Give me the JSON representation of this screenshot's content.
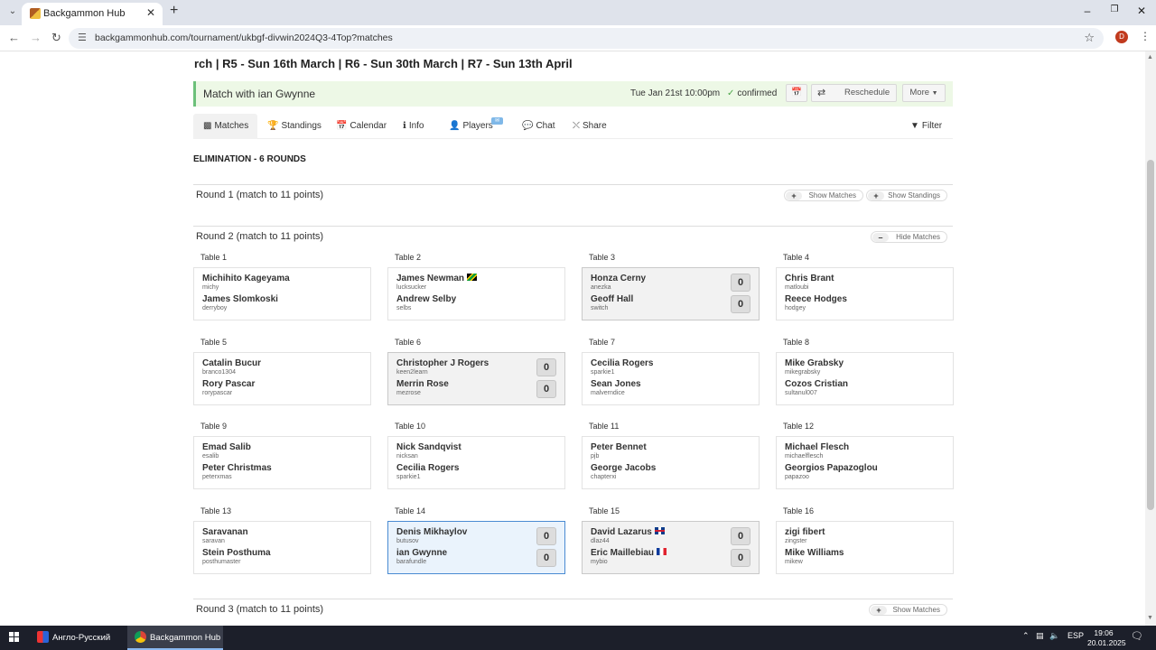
{
  "browser": {
    "tab_title": "Backgammon Hub",
    "url": "backgammonhub.com/tournament/ukbgf-divwin2024Q3-4Top?matches",
    "profile_initial": "D"
  },
  "page": {
    "rounds_title": "rch | R5 - Sun 16th March | R6 - Sun 30th March | R7 - Sun 13th April",
    "match_banner": {
      "title": "Match with ian Gwynne",
      "time": "Tue Jan 21st 10:00pm",
      "status": "confirmed",
      "reschedule_label": "Reschedule",
      "more_label": "More"
    },
    "nav": {
      "matches": "Matches",
      "standings": "Standings",
      "calendar": "Calendar",
      "info": "Info",
      "players": "Players",
      "chat": "Chat",
      "share": "Share",
      "filter": "Filter"
    },
    "elimination_title": "ELIMINATION - 6 ROUNDS",
    "rounds": [
      {
        "title": "Round 1 (match to 11 points)",
        "show_matches": "Show Matches",
        "show_standings": "Show Standings"
      },
      {
        "title": "Round 2 (match to 11 points)",
        "hide_matches": "Hide Matches"
      },
      {
        "title": "Round 3 (match to 11 points)",
        "show_matches": "Show Matches"
      }
    ],
    "tables": [
      {
        "label": "Table 1",
        "p1": "Michihito Kageyama",
        "u1": "michy",
        "p2": "James Slomkoski",
        "u2": "derryboy"
      },
      {
        "label": "Table 2",
        "p1": "James Newman",
        "u1": "lucksucker",
        "p2": "Andrew Selby",
        "u2": "selbs"
      },
      {
        "label": "Table 3",
        "p1": "Honza Cerny",
        "u1": "anezka",
        "p2": "Geoff Hall",
        "u2": "switch",
        "s1": "0",
        "s2": "0"
      },
      {
        "label": "Table 4",
        "p1": "Chris Brant",
        "u1": "matloubi",
        "p2": "Reece Hodges",
        "u2": "hodgey"
      },
      {
        "label": "Table 5",
        "p1": "Catalin Bucur",
        "u1": "branco1304",
        "p2": "Rory Pascar",
        "u2": "rorypascar"
      },
      {
        "label": "Table 6",
        "p1": "Christopher J Rogers",
        "u1": "keen2learn",
        "p2": "Merrin Rose",
        "u2": "mezrose",
        "s1": "0",
        "s2": "0"
      },
      {
        "label": "Table 7",
        "p1": "Cecilia Rogers",
        "u1": "sparkie1",
        "p2": "Sean Jones",
        "u2": "malverndice"
      },
      {
        "label": "Table 8",
        "p1": "Mike Grabsky",
        "u1": "mikegrabsky",
        "p2": "Cozos Cristian",
        "u2": "sultanul007"
      },
      {
        "label": "Table 9",
        "p1": "Emad Salib",
        "u1": "esalib",
        "p2": "Peter Christmas",
        "u2": "peterxmas"
      },
      {
        "label": "Table 10",
        "p1": "Nick Sandqvist",
        "u1": "nicksan",
        "p2": "Cecilia Rogers",
        "u2": "sparkie1"
      },
      {
        "label": "Table 11",
        "p1": "Peter Bennet",
        "u1": "pjb",
        "p2": "George Jacobs",
        "u2": "chapterxi"
      },
      {
        "label": "Table 12",
        "p1": "Michael Flesch",
        "u1": "michaelflesch",
        "p2": "Georgios Papazoglou",
        "u2": "papazoo"
      },
      {
        "label": "Table 13",
        "p1": "Saravanan",
        "u1": "saravan",
        "p2": "Stein Posthuma",
        "u2": "posthumaster"
      },
      {
        "label": "Table 14",
        "p1": "Denis Mikhaylov",
        "u1": "butusov",
        "p2": "ian Gwynne",
        "u2": "barafundle",
        "s1": "0",
        "s2": "0"
      },
      {
        "label": "Table 15",
        "p1": "David Lazarus",
        "u1": "dlaz44",
        "p2": "Eric Maillebiau",
        "u2": "mybio",
        "s1": "0",
        "s2": "0"
      },
      {
        "label": "Table 16",
        "p1": "zigi fibert",
        "u1": "zingster",
        "p2": "Mike Williams",
        "u2": "mikew"
      }
    ]
  },
  "taskbar": {
    "item1": "Англо-Русский",
    "item2": "Backgammon Hub ...",
    "lang": "ESP",
    "time": "19:06",
    "date": "20.01.2025"
  }
}
